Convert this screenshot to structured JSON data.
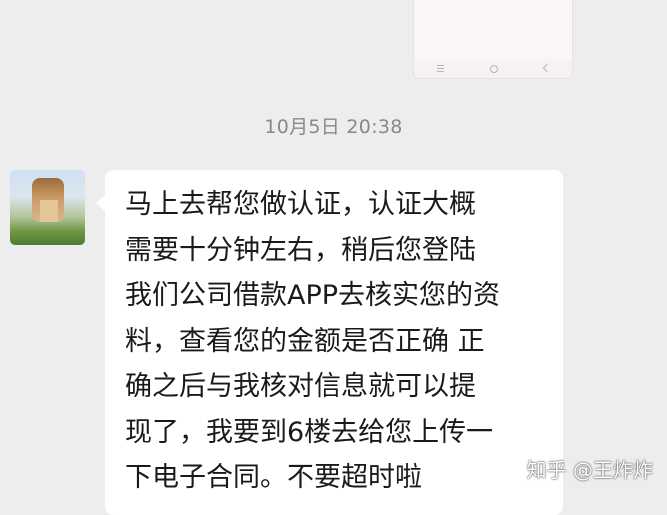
{
  "chat": {
    "timestamp": "10月5日 20:38",
    "message": {
      "sender_avatar": "avatar",
      "text": "马上去帮您做认证，认证大概\n需要十分钟左右，稍后您登陆\n我们公司借款APP去核实您的资\n料，查看您的金额是否正确 正\n确之后与我核对信息就可以提\n现了，我要到6楼去给您上传一\n下电子合同。不要超时啦"
    }
  },
  "watermark": {
    "text": "知乎 @王炸炸"
  },
  "colors": {
    "background": "#ededed",
    "bubble": "#ffffff",
    "timestamp": "#888888"
  }
}
